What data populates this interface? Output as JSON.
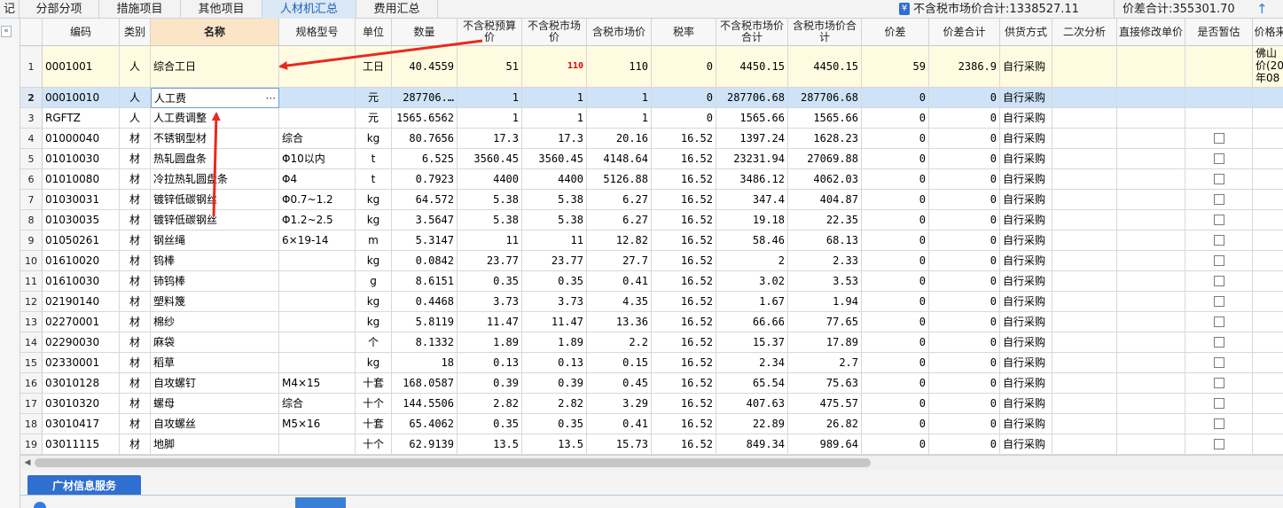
{
  "topbar": {
    "tabs": [
      {
        "label": "分部分项",
        "active": false
      },
      {
        "label": "措施项目",
        "active": false
      },
      {
        "label": "其他项目",
        "active": false
      },
      {
        "label": "人材机汇总",
        "active": true
      },
      {
        "label": "费用汇总",
        "active": false
      }
    ],
    "left_fragment": "记",
    "market_total_label": "不含税市场价合计:1338527.11",
    "diff_total_label": "价差合计:355301.70"
  },
  "left_strip": {
    "collapse_glyph": "«"
  },
  "grid": {
    "columns": [
      "",
      "编码",
      "类别",
      "名称",
      "规格型号",
      "单位",
      "数量",
      "不含税预算价",
      "不含税市场价",
      "含税市场价",
      "税率",
      "不含税市场价合计",
      "含税市场价合计",
      "价差",
      "价差合计",
      "供货方式",
      "二次分析",
      "直接修改单价",
      "是否暂估",
      "价格来"
    ],
    "rows": [
      {
        "no": "1",
        "code": "0001001",
        "cat": "人",
        "name": "综合工日",
        "spec": "",
        "unit": "工日",
        "qty": "40.4559",
        "budget": "51",
        "market": "110",
        "tax_market": "110",
        "rate": "0",
        "market_total": "4450.15",
        "tax_total": "4450.15",
        "diff": "59",
        "diff_total": "2386.9",
        "supply": "自行采购",
        "source": "佛山价(20年08",
        "check": false
      },
      {
        "no": "2",
        "code": "00010010",
        "cat": "人",
        "name": "人工费",
        "spec": "",
        "unit": "元",
        "qty": "287706.…",
        "budget": "1",
        "market": "1",
        "tax_market": "1",
        "rate": "0",
        "market_total": "287706.68",
        "tax_total": "287706.68",
        "diff": "0",
        "diff_total": "0",
        "supply": "自行采购",
        "source": "",
        "check": false
      },
      {
        "no": "3",
        "code": "RGFTZ",
        "cat": "人",
        "name": "人工费调整",
        "spec": "",
        "unit": "元",
        "qty": "1565.6562",
        "budget": "1",
        "market": "1",
        "tax_market": "1",
        "rate": "0",
        "market_total": "1565.66",
        "tax_total": "1565.66",
        "diff": "0",
        "diff_total": "0",
        "supply": "自行采购",
        "source": "",
        "check": false
      },
      {
        "no": "4",
        "code": "01000040",
        "cat": "材",
        "name": "不锈钢型材",
        "spec": "综合",
        "unit": "kg",
        "qty": "80.7656",
        "budget": "17.3",
        "market": "17.3",
        "tax_market": "20.16",
        "rate": "16.52",
        "market_total": "1397.24",
        "tax_total": "1628.23",
        "diff": "0",
        "diff_total": "0",
        "supply": "自行采购",
        "source": "",
        "check": true
      },
      {
        "no": "5",
        "code": "01010030",
        "cat": "材",
        "name": "热轧圆盘条",
        "spec": "Φ10以内",
        "unit": "t",
        "qty": "6.525",
        "budget": "3560.45",
        "market": "3560.45",
        "tax_market": "4148.64",
        "rate": "16.52",
        "market_total": "23231.94",
        "tax_total": "27069.88",
        "diff": "0",
        "diff_total": "0",
        "supply": "自行采购",
        "source": "",
        "check": true
      },
      {
        "no": "6",
        "code": "01010080",
        "cat": "材",
        "name": "冷拉热轧圆盘条",
        "spec": "Φ4",
        "unit": "t",
        "qty": "0.7923",
        "budget": "4400",
        "market": "4400",
        "tax_market": "5126.88",
        "rate": "16.52",
        "market_total": "3486.12",
        "tax_total": "4062.03",
        "diff": "0",
        "diff_total": "0",
        "supply": "自行采购",
        "source": "",
        "check": true
      },
      {
        "no": "7",
        "code": "01030031",
        "cat": "材",
        "name": "镀锌低碳钢丝",
        "spec": "Φ0.7~1.2",
        "unit": "kg",
        "qty": "64.572",
        "budget": "5.38",
        "market": "5.38",
        "tax_market": "6.27",
        "rate": "16.52",
        "market_total": "347.4",
        "tax_total": "404.87",
        "diff": "0",
        "diff_total": "0",
        "supply": "自行采购",
        "source": "",
        "check": true
      },
      {
        "no": "8",
        "code": "01030035",
        "cat": "材",
        "name": "镀锌低碳钢丝",
        "spec": "Φ1.2~2.5",
        "unit": "kg",
        "qty": "3.5647",
        "budget": "5.38",
        "market": "5.38",
        "tax_market": "6.27",
        "rate": "16.52",
        "market_total": "19.18",
        "tax_total": "22.35",
        "diff": "0",
        "diff_total": "0",
        "supply": "自行采购",
        "source": "",
        "check": true
      },
      {
        "no": "9",
        "code": "01050261",
        "cat": "材",
        "name": "钢丝绳",
        "spec": "6×19-14",
        "unit": "m",
        "qty": "5.3147",
        "budget": "11",
        "market": "11",
        "tax_market": "12.82",
        "rate": "16.52",
        "market_total": "58.46",
        "tax_total": "68.13",
        "diff": "0",
        "diff_total": "0",
        "supply": "自行采购",
        "source": "",
        "check": true
      },
      {
        "no": "10",
        "code": "01610020",
        "cat": "材",
        "name": "钨棒",
        "spec": "",
        "unit": "kg",
        "qty": "0.0842",
        "budget": "23.77",
        "market": "23.77",
        "tax_market": "27.7",
        "rate": "16.52",
        "market_total": "2",
        "tax_total": "2.33",
        "diff": "0",
        "diff_total": "0",
        "supply": "自行采购",
        "source": "",
        "check": true
      },
      {
        "no": "11",
        "code": "01610030",
        "cat": "材",
        "name": "铈钨棒",
        "spec": "",
        "unit": "g",
        "qty": "8.6151",
        "budget": "0.35",
        "market": "0.35",
        "tax_market": "0.41",
        "rate": "16.52",
        "market_total": "3.02",
        "tax_total": "3.53",
        "diff": "0",
        "diff_total": "0",
        "supply": "自行采购",
        "source": "",
        "check": true
      },
      {
        "no": "12",
        "code": "02190140",
        "cat": "材",
        "name": "塑料篾",
        "spec": "",
        "unit": "kg",
        "qty": "0.4468",
        "budget": "3.73",
        "market": "3.73",
        "tax_market": "4.35",
        "rate": "16.52",
        "market_total": "1.67",
        "tax_total": "1.94",
        "diff": "0",
        "diff_total": "0",
        "supply": "自行采购",
        "source": "",
        "check": true
      },
      {
        "no": "13",
        "code": "02270001",
        "cat": "材",
        "name": "棉纱",
        "spec": "",
        "unit": "kg",
        "qty": "5.8119",
        "budget": "11.47",
        "market": "11.47",
        "tax_market": "13.36",
        "rate": "16.52",
        "market_total": "66.66",
        "tax_total": "77.65",
        "diff": "0",
        "diff_total": "0",
        "supply": "自行采购",
        "source": "",
        "check": true
      },
      {
        "no": "14",
        "code": "02290030",
        "cat": "材",
        "name": "麻袋",
        "spec": "",
        "unit": "个",
        "qty": "8.1332",
        "budget": "1.89",
        "market": "1.89",
        "tax_market": "2.2",
        "rate": "16.52",
        "market_total": "15.37",
        "tax_total": "17.89",
        "diff": "0",
        "diff_total": "0",
        "supply": "自行采购",
        "source": "",
        "check": true
      },
      {
        "no": "15",
        "code": "02330001",
        "cat": "材",
        "name": "稻草",
        "spec": "",
        "unit": "kg",
        "qty": "18",
        "budget": "0.13",
        "market": "0.13",
        "tax_market": "0.15",
        "rate": "16.52",
        "market_total": "2.34",
        "tax_total": "2.7",
        "diff": "0",
        "diff_total": "0",
        "supply": "自行采购",
        "source": "",
        "check": true
      },
      {
        "no": "16",
        "code": "03010128",
        "cat": "材",
        "name": "自攻螺钉",
        "spec": "M4×15",
        "unit": "十套",
        "qty": "168.0587",
        "budget": "0.39",
        "market": "0.39",
        "tax_market": "0.45",
        "rate": "16.52",
        "market_total": "65.54",
        "tax_total": "75.63",
        "diff": "0",
        "diff_total": "0",
        "supply": "自行采购",
        "source": "",
        "check": true
      },
      {
        "no": "17",
        "code": "03010320",
        "cat": "材",
        "name": "螺母",
        "spec": "综合",
        "unit": "十个",
        "qty": "144.5506",
        "budget": "2.82",
        "market": "2.82",
        "tax_market": "3.29",
        "rate": "16.52",
        "market_total": "407.63",
        "tax_total": "475.57",
        "diff": "0",
        "diff_total": "0",
        "supply": "自行采购",
        "source": "",
        "check": true
      },
      {
        "no": "18",
        "code": "03010417",
        "cat": "材",
        "name": "自攻螺丝",
        "spec": "M5×16",
        "unit": "十套",
        "qty": "65.4062",
        "budget": "0.35",
        "market": "0.35",
        "tax_market": "0.41",
        "rate": "16.52",
        "market_total": "22.89",
        "tax_total": "26.82",
        "diff": "0",
        "diff_total": "0",
        "supply": "自行采购",
        "source": "",
        "check": true
      },
      {
        "no": "19",
        "code": "03011115",
        "cat": "材",
        "name": "地脚",
        "spec": "",
        "unit": "十个",
        "qty": "62.9139",
        "budget": "13.5",
        "market": "13.5",
        "tax_market": "15.73",
        "rate": "16.52",
        "market_total": "849.34",
        "tax_total": "989.64",
        "diff": "0",
        "diff_total": "0",
        "supply": "自行采购",
        "source": "",
        "check": true
      }
    ],
    "edit_dots": "···"
  },
  "bottom": {
    "tab_label": "广材信息服务"
  },
  "colors": {
    "active_tab": "#dbe8f5",
    "first_row_bg": "#fefbe1",
    "selected_row_bg": "#cfe3f8",
    "arrow": "#e8291e",
    "accent": "#2f6fd0"
  }
}
